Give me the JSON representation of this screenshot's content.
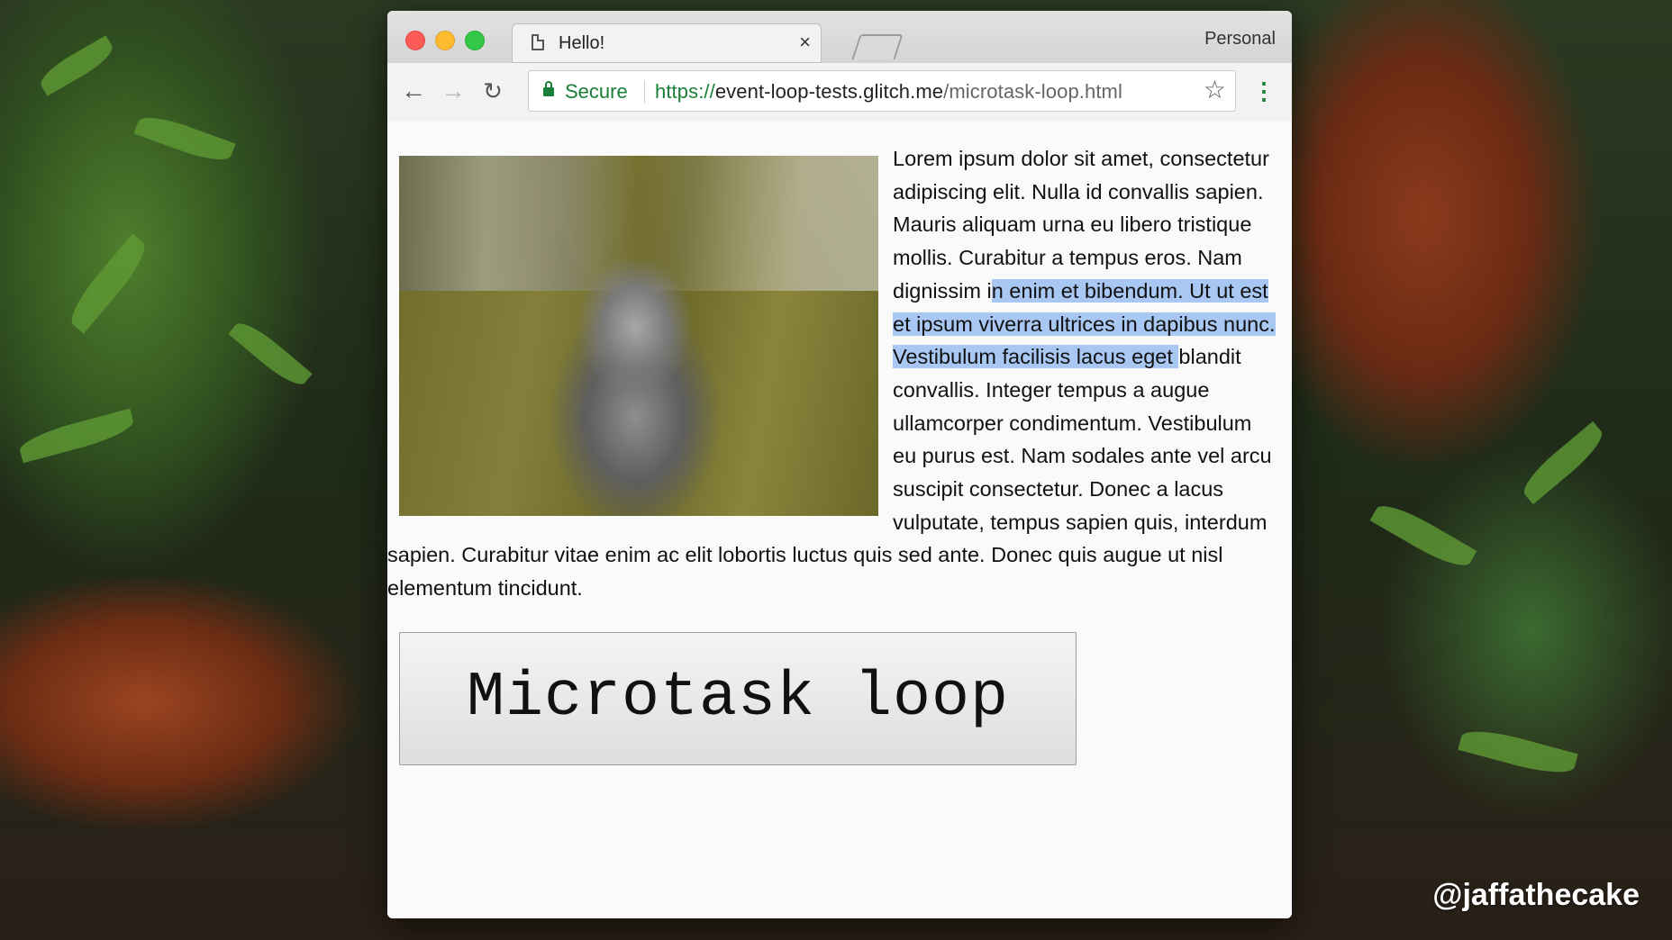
{
  "browser": {
    "tab_title": "Hello!",
    "tab_close_glyph": "×",
    "profile": "Personal",
    "secure_label": "Secure",
    "url_scheme": "https://",
    "url_host": "event-loop-tests.glitch.me",
    "url_path": "/microtask-loop.html",
    "icons": {
      "back": "back-arrow-icon",
      "forward": "forward-arrow-icon",
      "reload": "reload-icon",
      "lock": "lock-icon",
      "bookmark": "star-icon",
      "menu": "kebab-menu-icon"
    },
    "colors": {
      "secure_green": "#188038",
      "selection": "#a8c7f2"
    }
  },
  "page": {
    "text_before_selection": "Lorem ipsum dolor sit amet, consectetur adipiscing elit. Nulla id convallis sapien. Mauris aliquam urna eu libero tristique mollis. Curabitur a tempus eros. Nam dignissim i",
    "selected_text": "n enim et bibendum. Ut ut est et ipsum viverra ultrices in dapibus nunc. Vestibulum facilisis lacus eget ",
    "text_after_selection": "blandit convallis. Integer tempus a augue ullamcorper condimentum. Vestibulum eu purus est. Nam sodales ante vel arcu suscipit consectetur. Donec a lacus vulputate, tempus sapien quis, interdum sapien. Curabitur vitae enim ac elit lobortis luctus quis sed ante. Donec quis augue ut nisl elementum tincidunt.",
    "button_label": "Microtask loop"
  },
  "watermark": "@jaffathecake"
}
